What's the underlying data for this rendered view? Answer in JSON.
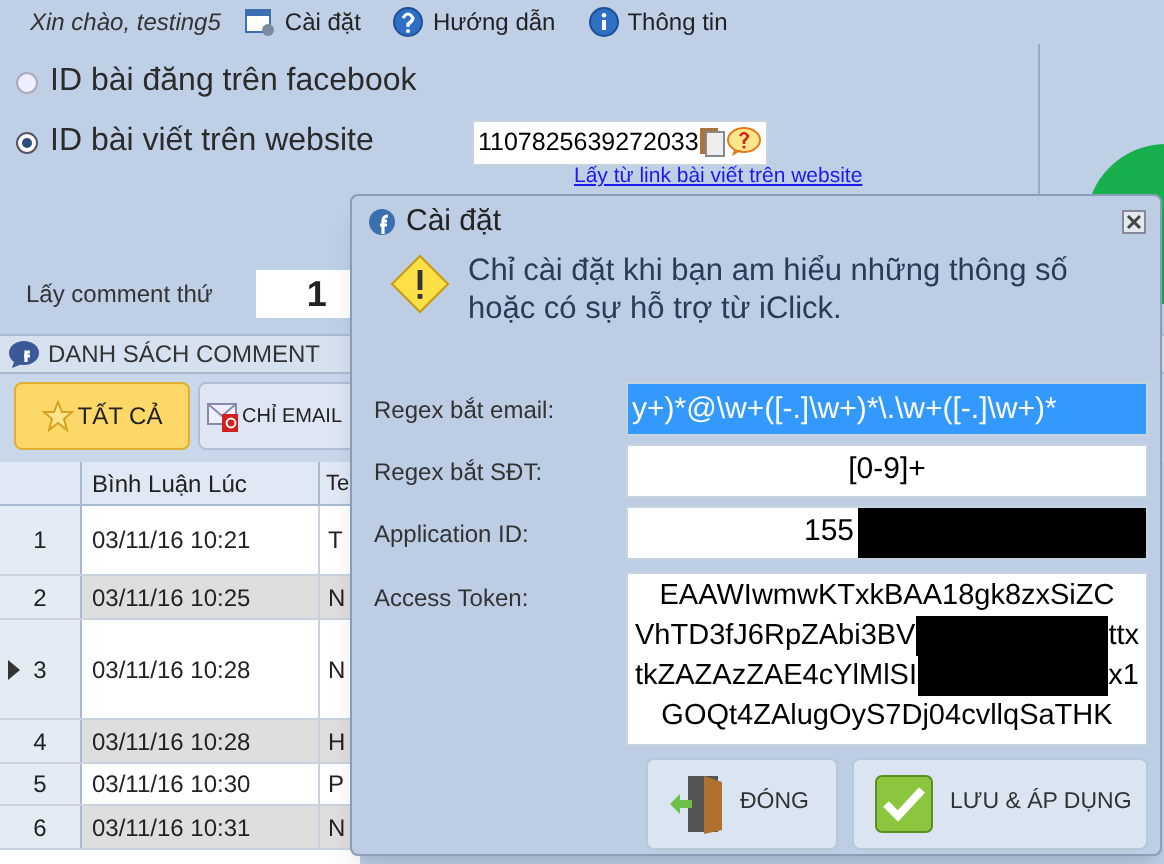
{
  "toolbar": {
    "greeting": "Xin chào, testing5",
    "items": [
      {
        "kind": "settings",
        "label": "Cài đặt"
      },
      {
        "kind": "help",
        "label": "Hướng dẫn"
      },
      {
        "kind": "info",
        "label": "Thông tin"
      }
    ]
  },
  "source": {
    "options": [
      {
        "label": "ID bài đăng trên facebook",
        "selected": false
      },
      {
        "label": "ID bài viết trên website",
        "selected": true
      }
    ],
    "post_id": "1107825639272033",
    "link": "Lấy từ link bài viết trên website"
  },
  "comment_index": {
    "label": "Lấy comment thứ",
    "value": "1"
  },
  "comment_list": {
    "title": "DANH SÁCH COMMENT",
    "filters": [
      {
        "kind": "all",
        "label": "TẤT CẢ",
        "selected": true
      },
      {
        "kind": "email",
        "label": "CHỈ EMAIL",
        "selected": false
      }
    ],
    "columns": [
      "Bình Luận Lúc",
      "Te"
    ],
    "rows": [
      {
        "index": "1",
        "time": "03/11/16 10:21",
        "column_3": "T",
        "selected": false
      },
      {
        "index": "2",
        "time": "03/11/16 10:25",
        "column_3": "N",
        "selected": false
      },
      {
        "index": "3",
        "time": "03/11/16 10:28",
        "column_3": "N",
        "selected": true
      },
      {
        "index": "4",
        "time": "03/11/16 10:28",
        "column_3": "H",
        "selected": false
      },
      {
        "index": "5",
        "time": "03/11/16 10:30",
        "column_3": "P",
        "selected": false
      },
      {
        "index": "6",
        "time": "03/11/16 10:31",
        "column_3": "N",
        "selected": false
      }
    ]
  },
  "dialog": {
    "title": "Cài đặt",
    "warning": "Chỉ cài đặt khi bạn am hiểu những thông số hoặc có sự hỗ trợ từ iClick.",
    "fields": [
      {
        "label": "Regex bắt email:",
        "value": "y+)*@\\w+([-.]\\w+)*\\.\\w+([-.]\\w+)*",
        "selected": true
      },
      {
        "label": "Regex bắt SĐT:",
        "value": "[0-9]+",
        "selected": false
      },
      {
        "label": "Application ID:",
        "value": "155",
        "redacted": true,
        "selected": false
      }
    ],
    "token": {
      "label": "Access Token:",
      "lines": [
        [
          "EAAWIwmwKTxkBAA18gk8zxSiZC"
        ],
        [
          "VhTD3fJ6RpZAbi3BV",
          "ttx"
        ],
        [
          "tkZAZAzZAE4cYlMlSI",
          "x1"
        ],
        [
          "GOQt4ZAlugOyS7Dj04cvllqSaTHK"
        ]
      ]
    },
    "buttons": [
      {
        "kind": "close",
        "label": "ĐÓNG"
      },
      {
        "kind": "save",
        "label": "LƯU & ÁP DỤNG"
      }
    ]
  }
}
